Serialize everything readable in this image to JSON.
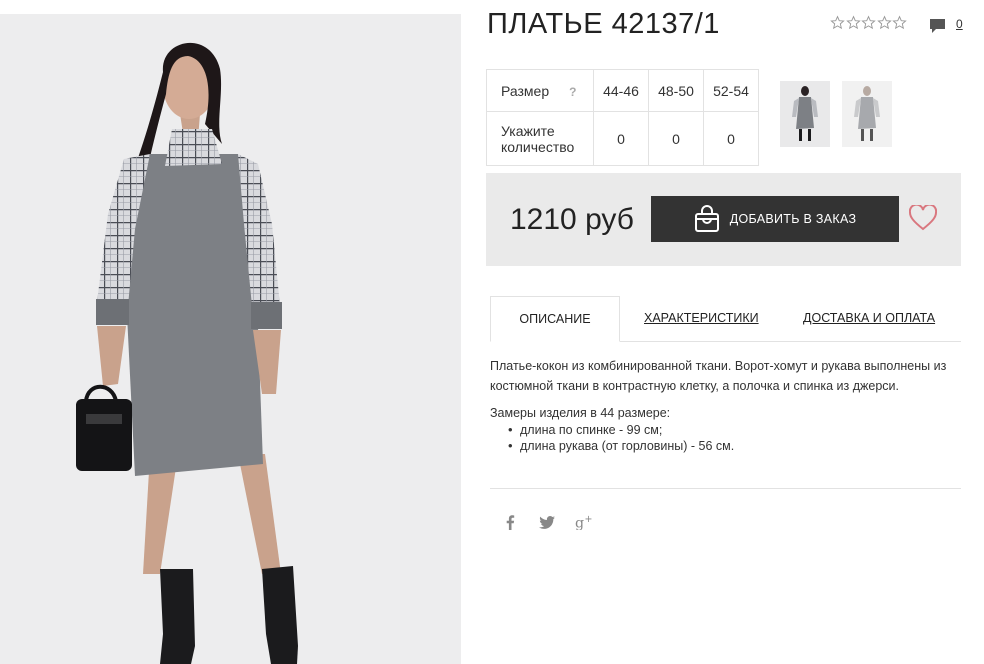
{
  "product": {
    "title": "ПЛАТЬЕ 42137/1",
    "image_alt": "dress photo"
  },
  "rating": {
    "stars_filled": 0,
    "stars_total": 5
  },
  "reviews": {
    "count": "0",
    "icon": "comment-icon"
  },
  "sizes_table": {
    "size_label": "Размер",
    "help": "?",
    "quantity_label_1": "Укажите",
    "quantity_label_2": "количество",
    "sizes": [
      "44-46",
      "48-50",
      "52-54"
    ],
    "quantities": [
      "0",
      "0",
      "0"
    ]
  },
  "price": {
    "value": "1210 руб",
    "add_button": "ДОБАВИТЬ В ЗАКАЗ",
    "cart_icon": "shopping-bag-icon",
    "favorite_icon": "heart-icon"
  },
  "tabs": [
    {
      "label": "ОПИСАНИЕ",
      "active": true
    },
    {
      "label": "ХАРАКТЕРИСТИКИ",
      "active": false
    },
    {
      "label": "ДОСТАВКА И ОПЛАТА",
      "active": false
    }
  ],
  "description": {
    "text": "Платье-кокон из комбинированной ткани. Ворот-хомут и рукава выполнены из костюмной ткани в контрастную клетку, а полочка и спинка из джерси.",
    "measurements_title": "Замеры изделия в 44 размере:",
    "measurements": [
      "длина по спинке - 99 см;",
      "длина рукава (от горловины) - 56 см."
    ]
  },
  "social": [
    "facebook-icon",
    "twitter-icon",
    "google-plus-icon"
  ],
  "colors": {
    "accent_dark": "#333333",
    "heart": "#d9777f",
    "price_bg": "#eaeaea"
  }
}
